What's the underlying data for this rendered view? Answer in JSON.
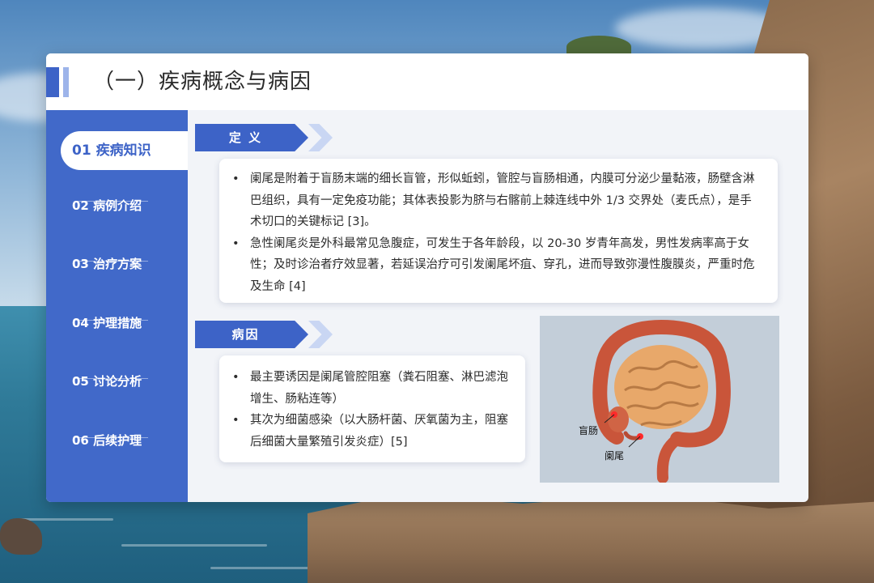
{
  "header": {
    "title": "（一）疾病概念与病因"
  },
  "sidebar": {
    "items": [
      {
        "label": "01 疾病知识",
        "active": true
      },
      {
        "label": "02 病例介绍",
        "active": false
      },
      {
        "label": "03 治疗方案",
        "active": false
      },
      {
        "label": "04 护理措施",
        "active": false
      },
      {
        "label": "05 讨论分析",
        "active": false
      },
      {
        "label": "06 后续护理",
        "active": false
      }
    ]
  },
  "sections": {
    "definition": {
      "tag": "定 义",
      "bullets": [
        "阑尾是附着于盲肠末端的细长盲管，形似蚯蚓，管腔与盲肠相通，内膜可分泌少量黏液，肠壁含淋巴组织，具有一定免疫功能；其体表投影为脐与右髂前上棘连线中外 1/3 交界处（麦氏点），是手术切口的关键标记 [3]。",
        "急性阑尾炎是外科最常见急腹症，可发生于各年龄段，以 20-30 岁青年高发，男性发病率高于女性；及时诊治者疗效显著，若延误治疗可引发阑尾坏疽、穿孔，进而导致弥漫性腹膜炎，严重时危及生命 [4]"
      ]
    },
    "cause": {
      "tag": "病因",
      "bullets": [
        "最主要诱因是阑尾管腔阻塞（粪石阻塞、淋巴滤泡增生、肠粘连等）",
        "其次为细菌感染（以大肠杆菌、厌氧菌为主，阻塞后细菌大量繁殖引发炎症）[5]"
      ]
    }
  },
  "illustration": {
    "label_cecum": "盲肠",
    "label_appendix": "阑尾"
  },
  "colors": {
    "accent": "#3d63c7",
    "accent_light": "#9db4ea",
    "panel": "#f2f4f8"
  }
}
